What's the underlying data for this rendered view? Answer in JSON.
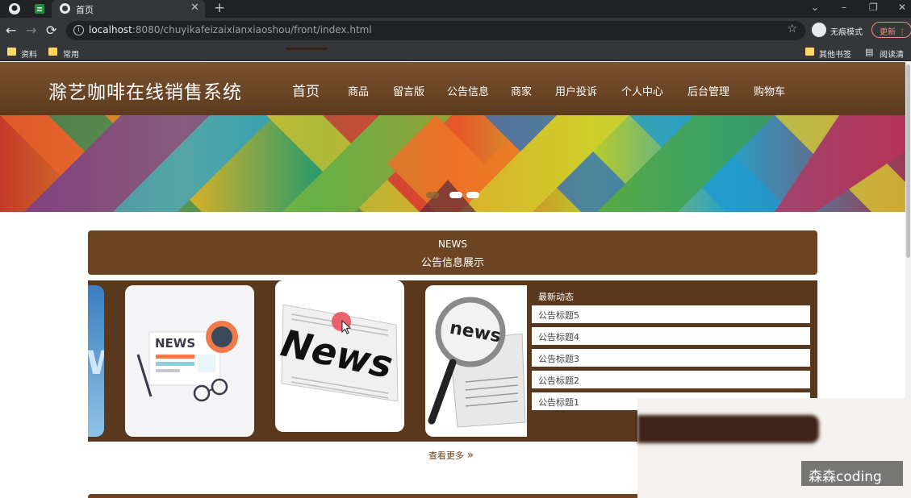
{
  "browser": {
    "tab_title": "首页",
    "tab_close": "✕",
    "new_tab": "+",
    "url_host": "localhost",
    "url_rest": ":8080/chuyikafeizaixianxiaoshou/front/index.html",
    "incognito_label": "无痕模式",
    "update_label": "更新",
    "bookmarks": [
      "资料",
      "常用"
    ],
    "other_bookmarks": "其他书签",
    "reading_list": "阅读清单"
  },
  "site": {
    "title": "滁艺咖啡在线销售系统",
    "nav": [
      "首页",
      "商品",
      "留言版",
      "公告信息",
      "商家",
      "用户投诉",
      "个人中心",
      "后台管理",
      "购物车"
    ]
  },
  "news": {
    "heading_en": "NEWS",
    "heading_cn": "公告信息展示",
    "latest_title": "最新动态",
    "items": [
      "公告标题5",
      "公告标题4",
      "公告标题3",
      "公告标题2",
      "公告标题1"
    ],
    "card_texts": [
      "NEWS",
      "News",
      "news"
    ],
    "more_label": "查看更多",
    "more_icon": "»"
  },
  "watermark": "森森coding",
  "colors": {
    "brand_brown": "#6d4422",
    "header_brown": "#7a5230",
    "panel_brown": "#5a381e"
  },
  "icons": {
    "back": "←",
    "forward": "→",
    "reload": "⟳",
    "star": "☆",
    "minimize": "–",
    "restore": "❐",
    "close": "✕"
  }
}
